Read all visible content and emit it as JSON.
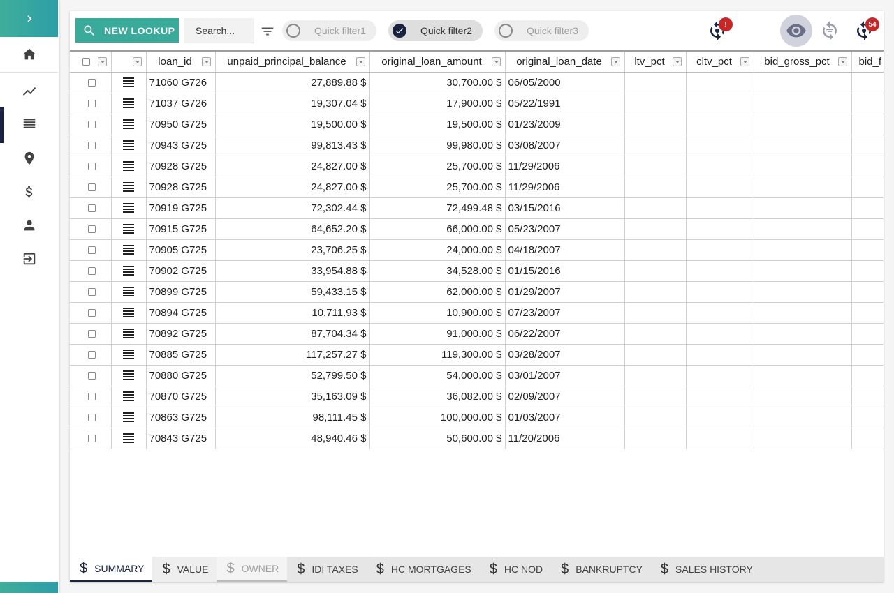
{
  "toolbar": {
    "lookup_label": "NEW LOOKUP",
    "search_placeholder": "Search...",
    "quick_filters": [
      {
        "label": "Quick filter1",
        "checked": false
      },
      {
        "label": "Quick filter2",
        "checked": true
      },
      {
        "label": "Quick filter3",
        "checked": false
      }
    ],
    "alert_badge": "!",
    "notification_badge": "54"
  },
  "grid": {
    "columns": [
      "loan_id",
      "unpaid_principal_balance",
      "original_loan_amount",
      "original_loan_date",
      "ltv_pct",
      "cltv_pct",
      "bid_gross_pct",
      "bid_f"
    ],
    "rows": [
      [
        "71060 G726",
        "27,889.88 $",
        "30,700.00 $",
        "06/05/2000"
      ],
      [
        "71037 G726",
        "19,307.04 $",
        "17,900.00 $",
        "05/22/1991"
      ],
      [
        "70950 G725",
        "19,500.00 $",
        "19,500.00 $",
        "01/23/2009"
      ],
      [
        "70943 G725",
        "99,813.43 $",
        "99,980.00 $",
        "03/08/2007"
      ],
      [
        "70928 G725",
        "24,827.00 $",
        "25,700.00 $",
        "11/29/2006"
      ],
      [
        "70928 G725",
        "24,827.00 $",
        "25,700.00 $",
        "11/29/2006"
      ],
      [
        "70919 G725",
        "72,302.44 $",
        "72,499.48 $",
        "03/15/2016"
      ],
      [
        "70915 G725",
        "64,652.20 $",
        "66,000.00 $",
        "05/23/2007"
      ],
      [
        "70905 G725",
        "23,706.25 $",
        "24,000.00 $",
        "04/18/2007"
      ],
      [
        "70902 G725",
        "33,954.88 $",
        "34,528.00 $",
        "01/15/2016"
      ],
      [
        "70899 G725",
        "59,433.15 $",
        "62,000.00 $",
        "01/29/2007"
      ],
      [
        "70894 G725",
        "10,711.93 $",
        "10,900.00 $",
        "07/23/2007"
      ],
      [
        "70892 G725",
        "87,704.34 $",
        "91,000.00 $",
        "06/22/2007"
      ],
      [
        "70885 G725",
        "117,257.27 $",
        "119,300.00 $",
        "03/28/2007"
      ],
      [
        "70880 G725",
        "52,799.50 $",
        "54,000.00 $",
        "03/01/2007"
      ],
      [
        "70870 G725",
        "35,163.09 $",
        "36,082.00 $",
        "02/09/2007"
      ],
      [
        "70863 G725",
        "98,111.45 $",
        "100,000.00 $",
        "01/03/2007"
      ],
      [
        "70843 G725",
        "48,940.46 $",
        "50,600.00 $",
        "11/20/2006"
      ]
    ]
  },
  "tabs": [
    {
      "label": "SUMMARY",
      "state": "active"
    },
    {
      "label": "VALUE",
      "state": "light"
    },
    {
      "label": "OWNER",
      "state": "muted"
    },
    {
      "label": "IDI TAXES",
      "state": "normal"
    },
    {
      "label": "HC MORTGAGES",
      "state": "normal"
    },
    {
      "label": "HC NOD",
      "state": "normal"
    },
    {
      "label": "BANKRUPTCY",
      "state": "normal"
    },
    {
      "label": "SALES HISTORY",
      "state": "normal"
    }
  ],
  "tab_symbol": "$",
  "colors": {
    "accent": "#3aab9b",
    "primary": "#1a2340",
    "badge": "#c62828"
  }
}
